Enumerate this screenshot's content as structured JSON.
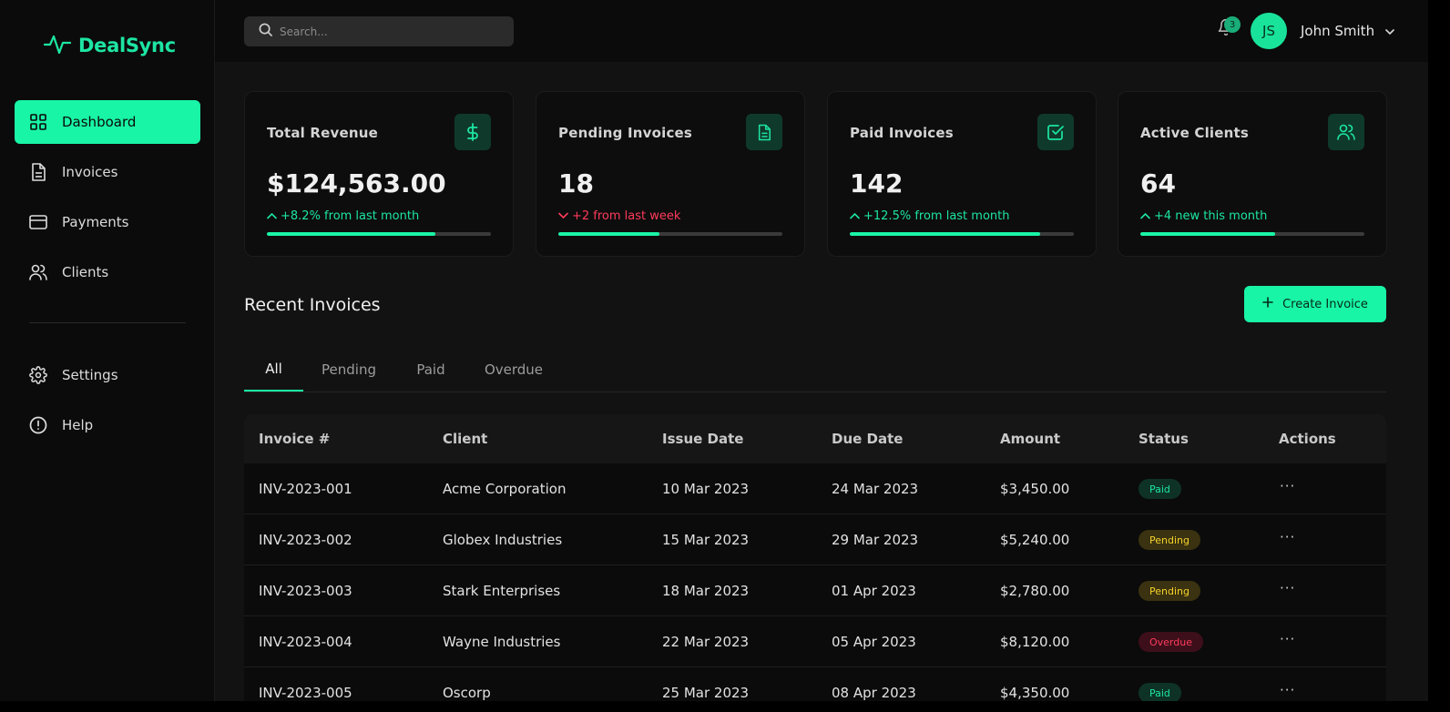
{
  "app": {
    "name": "DealSync"
  },
  "sidebar": {
    "items": [
      {
        "label": "Dashboard",
        "icon": "grid-icon",
        "active": true
      },
      {
        "label": "Invoices",
        "icon": "document-icon"
      },
      {
        "label": "Payments",
        "icon": "credit-card-icon"
      },
      {
        "label": "Clients",
        "icon": "users-icon"
      }
    ],
    "secondary": [
      {
        "label": "Settings",
        "icon": "gear-icon"
      },
      {
        "label": "Help",
        "icon": "alert-circle-icon"
      }
    ]
  },
  "header": {
    "search_placeholder": "Search...",
    "notification_count": "3",
    "user_initials": "JS",
    "user_name": "John Smith"
  },
  "stats": [
    {
      "title": "Total Revenue",
      "value": "$124,563.00",
      "change": "+8.2% from last month",
      "trend": "up",
      "icon": "dollar-icon",
      "progress": 0.75
    },
    {
      "title": "Pending Invoices",
      "value": "18",
      "change": "+2 from last week",
      "trend": "down",
      "icon": "document-icon",
      "progress": 0.45
    },
    {
      "title": "Paid Invoices",
      "value": "142",
      "change": "+12.5% from last month",
      "trend": "up",
      "icon": "check-square-icon",
      "progress": 0.85
    },
    {
      "title": "Active Clients",
      "value": "64",
      "change": "+4 new this month",
      "trend": "up",
      "icon": "users-icon",
      "progress": 0.6
    }
  ],
  "section": {
    "title": "Recent Invoices",
    "create_label": "Create Invoice"
  },
  "tabs": [
    {
      "label": "All",
      "active": true
    },
    {
      "label": "Pending"
    },
    {
      "label": "Paid"
    },
    {
      "label": "Overdue"
    }
  ],
  "table": {
    "headers": [
      "Invoice #",
      "Client",
      "Issue Date",
      "Due Date",
      "Amount",
      "Status",
      "Actions"
    ],
    "rows": [
      {
        "invoice": "INV-2023-001",
        "client": "Acme Corporation",
        "issue": "10 Mar 2023",
        "due": "24 Mar 2023",
        "amount": "$3,450.00",
        "status": "Paid",
        "actions": "···"
      },
      {
        "invoice": "INV-2023-002",
        "client": "Globex Industries",
        "issue": "15 Mar 2023",
        "due": "29 Mar 2023",
        "amount": "$5,240.00",
        "status": "Pending",
        "actions": "···"
      },
      {
        "invoice": "INV-2023-003",
        "client": "Stark Enterprises",
        "issue": "18 Mar 2023",
        "due": "01 Apr 2023",
        "amount": "$2,780.00",
        "status": "Pending",
        "actions": "···"
      },
      {
        "invoice": "INV-2023-004",
        "client": "Wayne Industries",
        "issue": "22 Mar 2023",
        "due": "05 Apr 2023",
        "amount": "$8,120.00",
        "status": "Overdue",
        "actions": "···"
      },
      {
        "invoice": "INV-2023-005",
        "client": "Oscorp",
        "issue": "25 Mar 2023",
        "due": "08 Apr 2023",
        "amount": "$4,350.00",
        "status": "Paid",
        "actions": "···"
      }
    ]
  },
  "colors": {
    "accent": "#19f5a6",
    "background": "#121212",
    "sidebar": "#0b0b0b",
    "danger": "#ff3b5c",
    "warning": "#f6d22b"
  }
}
